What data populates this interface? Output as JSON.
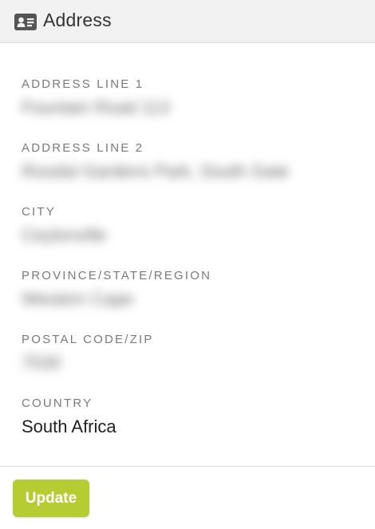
{
  "header": {
    "icon": "id-card-icon",
    "title": "Address"
  },
  "fields": [
    {
      "label": "ADDRESS LINE 1",
      "value": "Fountain Road 113"
    },
    {
      "label": "ADDRESS LINE 2",
      "value": "Roodal Gardens Park, South Gate"
    },
    {
      "label": "CITY",
      "value": "Ceylonville"
    },
    {
      "label": "PROVINCE/STATE/REGION",
      "value": "Western Cape"
    },
    {
      "label": "POSTAL CODE/ZIP",
      "value": "7530"
    },
    {
      "label": "COUNTRY",
      "value": "South Africa"
    }
  ],
  "footer": {
    "update_label": "Update"
  },
  "colors": {
    "accent": "#b5cc32",
    "label": "#7a7a7a",
    "header_bg": "#f2f2f2"
  }
}
